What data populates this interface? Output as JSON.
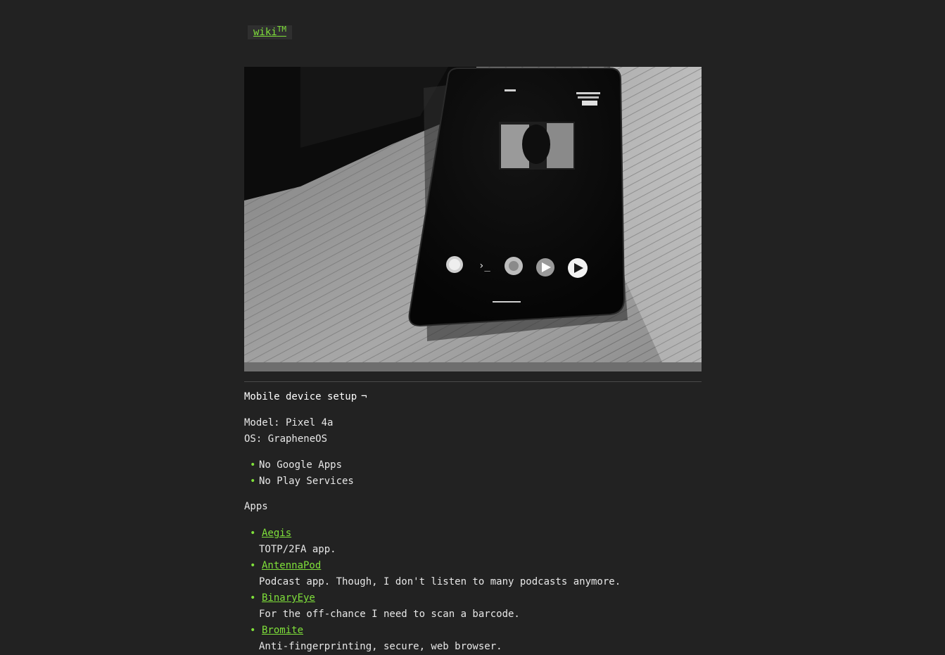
{
  "header": {
    "home_link": "wiki",
    "home_link_sup": "TM"
  },
  "hero_image": {
    "alt": "Pixel phone lying on an open lined notebook, black and white photo"
  },
  "section": {
    "heading": "Mobile device setup",
    "anchor": "¬",
    "model_line": "Model: Pixel 4a",
    "os_line": "OS: GrapheneOS",
    "flags": [
      "No Google Apps",
      "No Play Services"
    ],
    "apps_title": "Apps",
    "apps": [
      {
        "name": "Aegis",
        "desc": "TOTP/2FA app."
      },
      {
        "name": "AntennaPod",
        "desc": "Podcast app. Though, I don't listen to many podcasts anymore."
      },
      {
        "name": "BinaryEye",
        "desc": "For the off-chance I need to scan a barcode."
      },
      {
        "name": "Bromite",
        "desc": "Anti-fingerprinting, secure, web browser."
      }
    ]
  },
  "colors": {
    "background": "#222222",
    "accent": "#7fe03a",
    "text": "#e8e8e8"
  }
}
